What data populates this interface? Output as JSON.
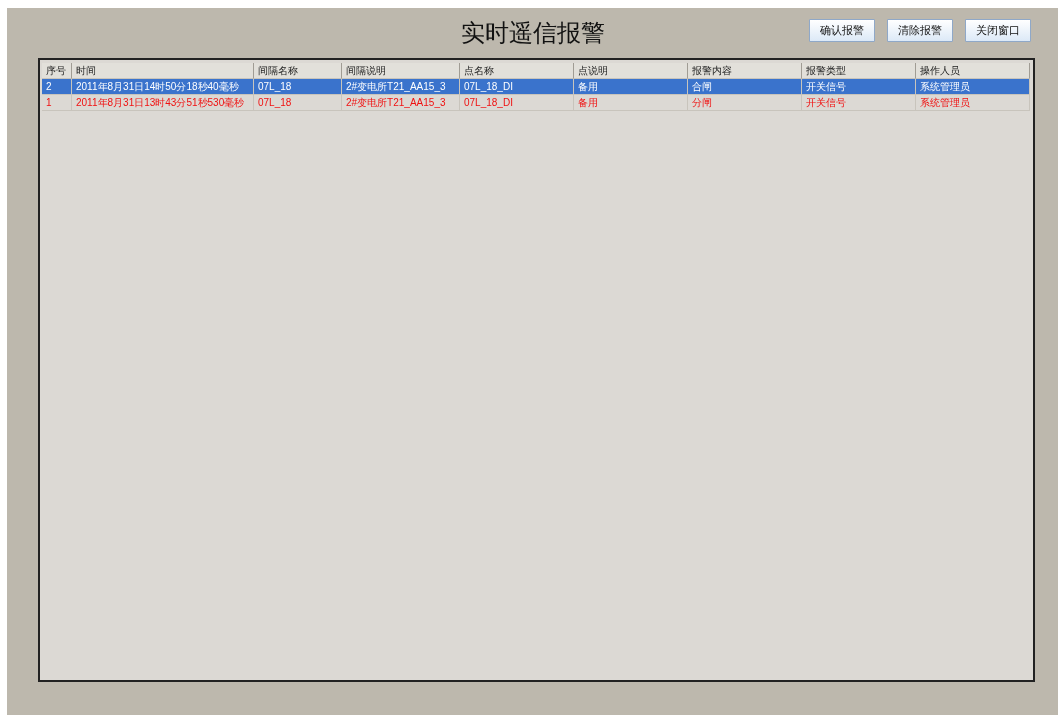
{
  "window": {
    "title": "实时遥信报警"
  },
  "buttons": [
    "确认报警",
    "清除报警",
    "关闭窗口"
  ],
  "table": {
    "columns": [
      "序号",
      "时间",
      "间隔名称",
      "间隔说明",
      "点名称",
      "点说明",
      "报警内容",
      "报警类型",
      "操作人员"
    ],
    "rows": [
      {
        "selected": true,
        "cells": [
          "2",
          "2011年8月31日14时50分18秒40毫秒",
          "07L_18",
          "2#变电所T21_AA15_3",
          "07L_18_DI",
          "备用",
          "合闸",
          "开关信号",
          "系统管理员"
        ]
      },
      {
        "selected": false,
        "cells": [
          "1",
          "2011年8月31日13时43分51秒530毫秒",
          "07L_18",
          "2#变电所T21_AA15_3",
          "07L_18_DI",
          "备用",
          "分闸",
          "开关信号",
          "系统管理员"
        ]
      }
    ]
  }
}
